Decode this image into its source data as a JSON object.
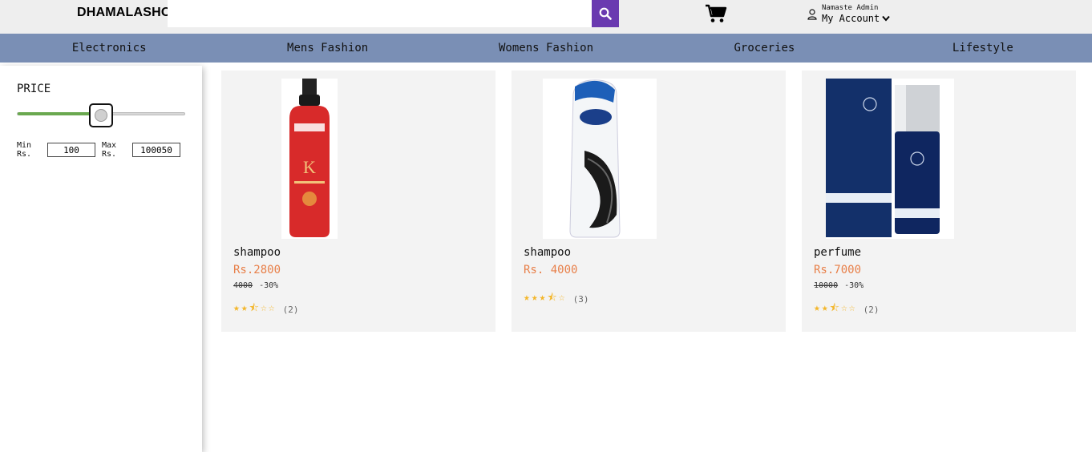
{
  "header": {
    "logo": "DHAMALASHOP",
    "search_placeholder": "",
    "greeting": "Namaste Admin",
    "account_label": "My Account"
  },
  "nav": {
    "items": [
      "Electronics",
      "Mens Fashion",
      "Womens Fashion",
      "Groceries",
      "Lifestyle"
    ]
  },
  "filter": {
    "title": "PRICE",
    "slider_fraction": 0.5,
    "min_label": "Min Rs.",
    "max_label": "Max Rs.",
    "min_value": "100",
    "max_value": "100050",
    "accent_color": "#6aa84f"
  },
  "products": [
    {
      "name": "shampoo",
      "price": "Rs.2800",
      "old_price": "4000",
      "discount": "-30%",
      "stars": 2.5,
      "rating_count": "(2)"
    },
    {
      "name": "shampoo",
      "price": "Rs. 4000",
      "old_price": "",
      "discount": "",
      "stars": 3.5,
      "rating_count": "(3)"
    },
    {
      "name": "perfume",
      "price": "Rs.7000",
      "old_price": "10000",
      "discount": "-30%",
      "stars": 2.5,
      "rating_count": "(2)"
    }
  ],
  "colors": {
    "nav_bg": "#7a8fb5",
    "search_button": "#6a3ab0",
    "price": "#e8804a",
    "star": "#f3b62a"
  },
  "icons": [
    "search-icon",
    "cart-icon",
    "user-icon",
    "chevron-down-icon",
    "star-icon"
  ]
}
